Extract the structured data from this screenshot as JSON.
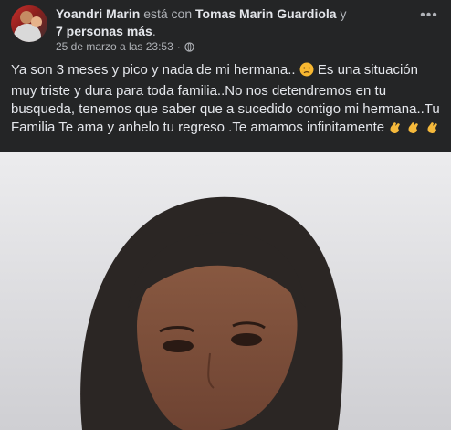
{
  "post": {
    "author": "Yoandri Marin",
    "with_word": "está con",
    "tagged": "Tomas Marin Guardiola",
    "and_word": "y",
    "others": "7 personas más",
    "period": ".",
    "timestamp": "25 de marzo a las 23:53",
    "separator": "·",
    "privacy_icon": "globe-icon",
    "more_icon": "more-options-icon",
    "text_part1": "Ya son 3 meses y pico y nada de mi hermana..",
    "text_part2": "Es una situación muy triste y dura para toda familia..No nos detendremos en tu busqueda, tenemos que saber que a sucedido contigo mi hermana..Tu Familia Te ama y anhelo tu regreso .Te amamos infinitamente",
    "emoji_sad": "sad-face-emoji",
    "emoji_clap": "clapping-hands-emoji"
  },
  "colors": {
    "background": "#242526",
    "primary_text": "#e4e6eb",
    "secondary_text": "#b0b3b8"
  }
}
